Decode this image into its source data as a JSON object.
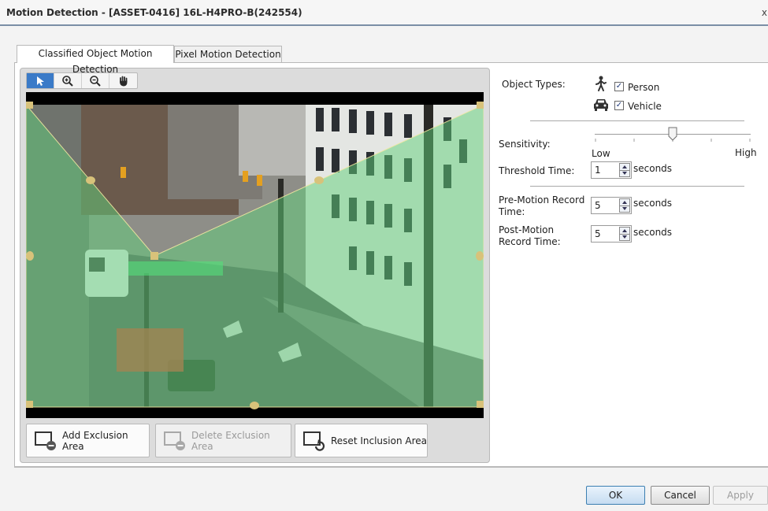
{
  "window": {
    "title": "Motion Detection - [ASSET-0416] 16L-H4PRO-B(242554)",
    "close_glyph": "x"
  },
  "tabs": [
    {
      "label": "Classified Object Motion Detection",
      "active": true
    },
    {
      "label": "Pixel Motion Detection",
      "active": false
    }
  ],
  "toolbar": {
    "tools": [
      "pointer-icon",
      "zoom-in-icon",
      "zoom-out-icon",
      "pan-hand-icon"
    ],
    "selected_index": 0,
    "accent": "#3b7bc8"
  },
  "video": {
    "overlay_color": "#5fd07a",
    "handle_color": "#d8c27a"
  },
  "area_buttons": {
    "add_label": "Add Exclusion Area",
    "delete_label": "Delete Exclusion Area",
    "reset_label": "Reset Inclusion Area"
  },
  "settings": {
    "object_types_label": "Object Types:",
    "person_label": "Person",
    "person_checked": true,
    "vehicle_label": "Vehicle",
    "vehicle_checked": true,
    "sensitivity_label": "Sensitivity:",
    "sensitivity_low": "Low",
    "sensitivity_high": "High",
    "sensitivity_level": 0.5,
    "threshold_label": "Threshold Time:",
    "threshold_value": "1",
    "threshold_unit": "seconds",
    "pre_motion_label_1": "Pre-Motion Record",
    "pre_motion_label_2": "Time:",
    "pre_motion_value": "5",
    "pre_motion_unit": "seconds",
    "post_motion_label_1": "Post-Motion",
    "post_motion_label_2": "Record Time:",
    "post_motion_value": "5",
    "post_motion_unit": "seconds"
  },
  "footer": {
    "ok_label": "OK",
    "cancel_label": "Cancel",
    "apply_label": "Apply"
  }
}
